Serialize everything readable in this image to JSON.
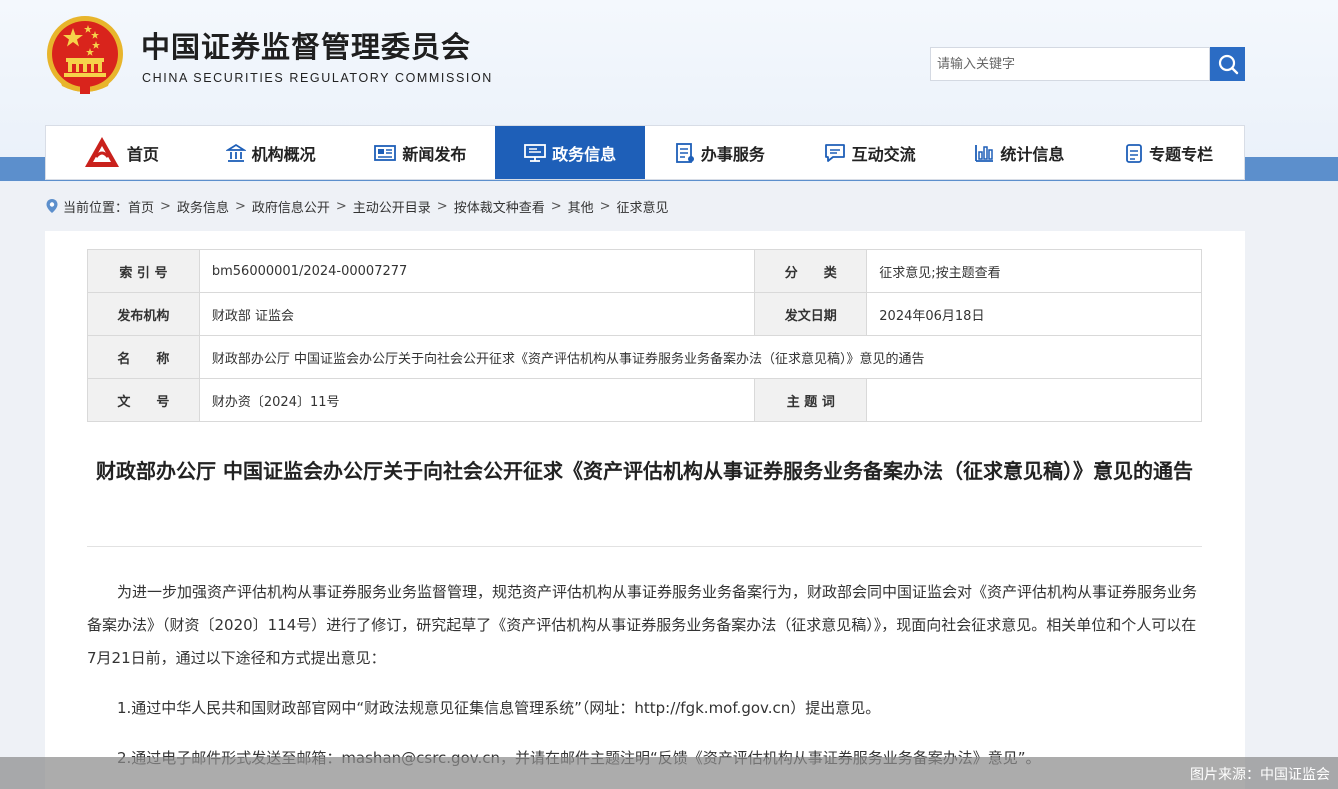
{
  "header": {
    "title": "中国证券监督管理委员会",
    "subtitle": "CHINA SECURITIES REGULATORY COMMISSION",
    "logo_icon": "national-emblem-icon",
    "search_placeholder": "请输入关键字"
  },
  "nav": [
    {
      "label": "首页",
      "icon": "csrc-logo-icon",
      "active": false
    },
    {
      "label": "机构概况",
      "icon": "building-icon",
      "active": false
    },
    {
      "label": "新闻发布",
      "icon": "newspaper-icon",
      "active": false
    },
    {
      "label": "政务信息",
      "icon": "monitor-icon",
      "active": true
    },
    {
      "label": "办事服务",
      "icon": "document-list-icon",
      "active": false
    },
    {
      "label": "互动交流",
      "icon": "chat-icon",
      "active": false
    },
    {
      "label": "统计信息",
      "icon": "bar-chart-icon",
      "active": false
    },
    {
      "label": "专题专栏",
      "icon": "clipboard-icon",
      "active": false
    }
  ],
  "breadcrumb": {
    "prefix": "当前位置：",
    "items": [
      "首页",
      "政务信息",
      "政府信息公开",
      "主动公开目录",
      "按体裁文种查看",
      "其他",
      "征求意见"
    ]
  },
  "meta": {
    "index_label": "索 引 号",
    "index_value": "bm56000001/2024-00007277",
    "category_label": "分　　类",
    "category_value": "征求意见;按主题查看",
    "issuer_label": "发布机构",
    "issuer_value": "财政部 证监会",
    "date_label": "发文日期",
    "date_value": "2024年06月18日",
    "name_label": "名　　称",
    "name_value": "财政部办公厅 中国证监会办公厅关于向社会公开征求《资产评估机构从事证券服务业务备案办法（征求意见稿）》意见的通告",
    "docno_label": "文　　号",
    "docno_value": "财办资〔2024〕11号",
    "keywords_label": "主 题 词",
    "keywords_value": ""
  },
  "article": {
    "title": "财政部办公厅 中国证监会办公厅关于向社会公开征求《资产评估机构从事证券服务业务备案办法（征求意见稿）》意见的通告",
    "paragraphs": [
      "为进一步加强资产评估机构从事证券服务业务监督管理，规范资产评估机构从事证券服务业务备案行为，财政部会同中国证监会对《资产评估机构从事证券服务业务备案办法》（财资〔2020〕114号）进行了修订，研究起草了《资产评估机构从事证券服务业务备案办法（征求意见稿）》，现面向社会征求意见。相关单位和个人可以在7月21日前，通过以下途径和方式提出意见：",
      "1.通过中华人民共和国财政部官网中“财政法规意见征集信息管理系统”（网址：http://fgk.mof.gov.cn）提出意见。",
      "2.通过电子邮件形式发送至邮箱：mashan@csrc.gov.cn，并请在邮件主题注明“反馈《资产评估机构从事证券服务业务备案办法》意见”。"
    ]
  },
  "caption": "图片来源：中国证监会",
  "colors": {
    "nav_active": "#1e5fb8",
    "search_button": "#2b6cc4",
    "band": "#5c8fcc",
    "emblem_red": "#d9241c",
    "emblem_gold": "#f2c02e"
  }
}
